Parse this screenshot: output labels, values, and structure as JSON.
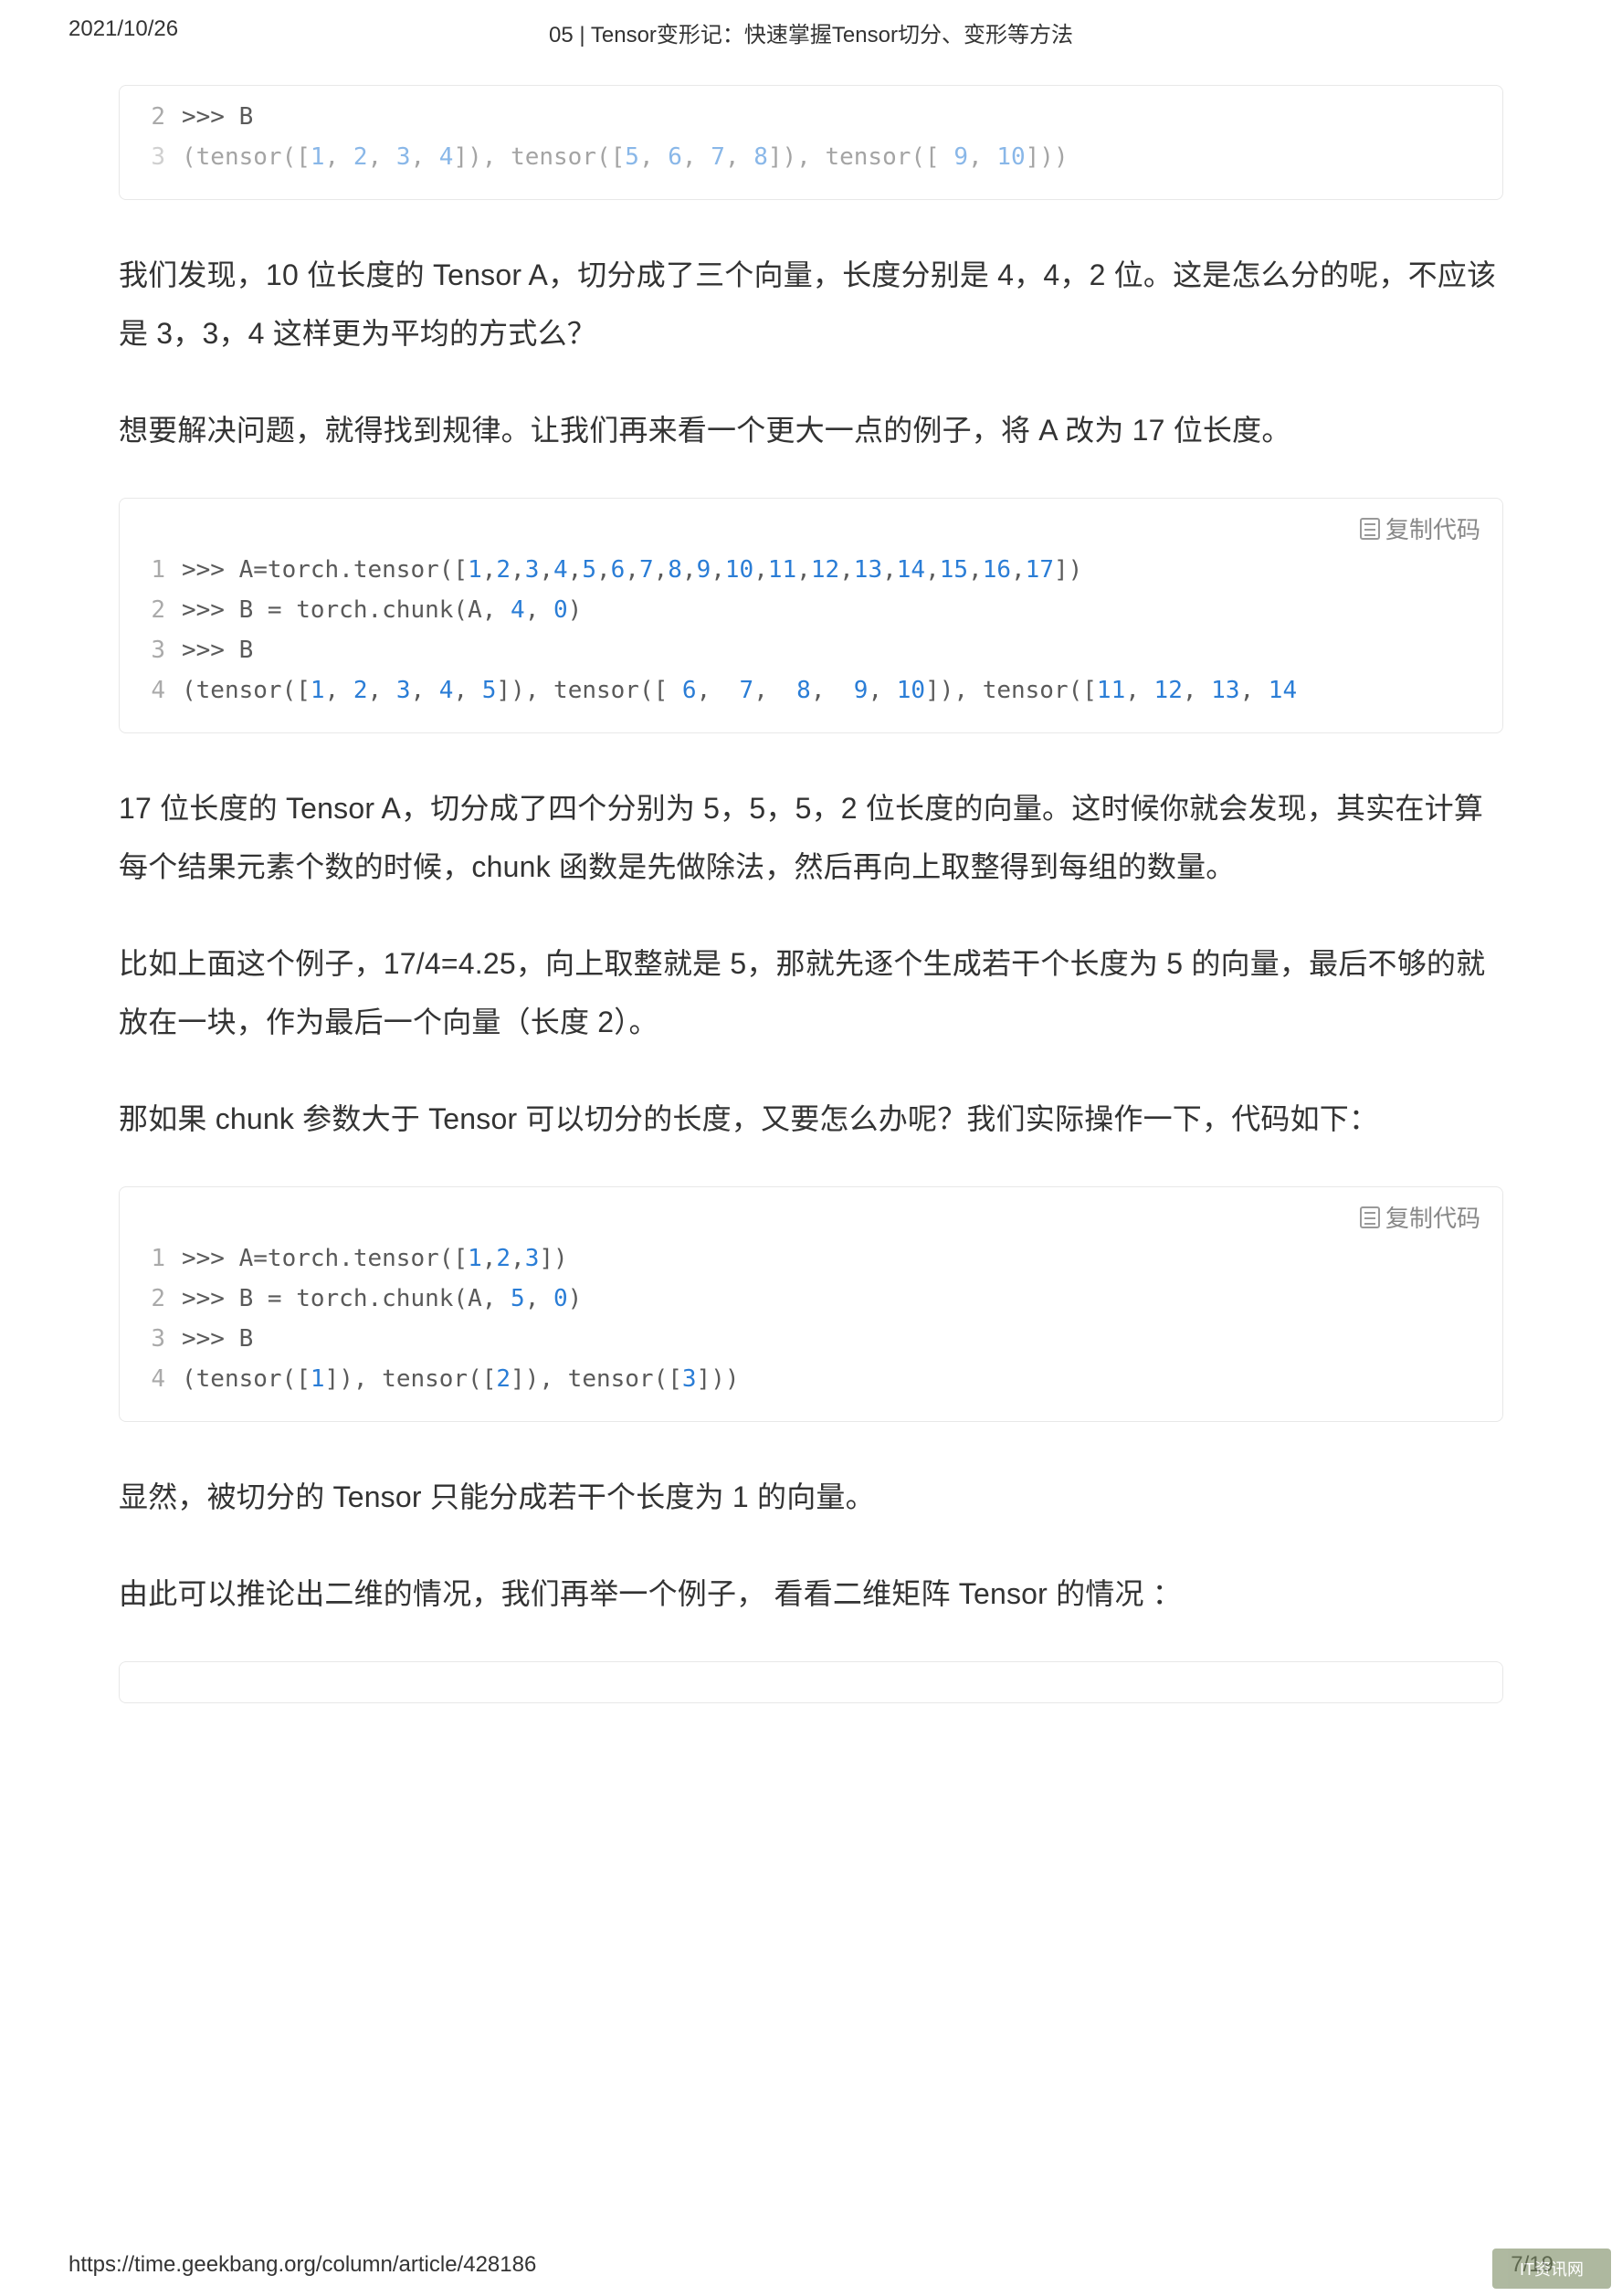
{
  "header": {
    "date": "2021/10/26",
    "title": "05 | Tensor变形记：快速掌握Tensor切分、变形等方法"
  },
  "copy_label": "复制代码",
  "code1": {
    "lines": [
      {
        "n": "2",
        "html": ">>> B"
      },
      {
        "n": "3",
        "html": "(tensor([<span class='tok-num'>1</span>, <span class='tok-num'>2</span>, <span class='tok-num'>3</span>, <span class='tok-num'>4</span>]), tensor([<span class='tok-num'>5</span>, <span class='tok-num'>6</span>, <span class='tok-num'>7</span>, <span class='tok-num'>8</span>]), tensor([ <span class='tok-num'>9</span>, <span class='tok-num'>10</span>]))"
      }
    ]
  },
  "p1": "我们发现，10 位长度的 Tensor A，切分成了三个向量，长度分别是 4，4，2 位。这是怎么分的呢，不应该是 3，3，4 这样更为平均的方式么？",
  "p2": "想要解决问题，就得找到规律。让我们再来看一个更大一点的例子，将 A 改为 17 位长度。",
  "code2": {
    "lines": [
      {
        "n": "1",
        "html": ">>> A=torch.tensor([<span class='tok-num'>1</span>,<span class='tok-num'>2</span>,<span class='tok-num'>3</span>,<span class='tok-num'>4</span>,<span class='tok-num'>5</span>,<span class='tok-num'>6</span>,<span class='tok-num'>7</span>,<span class='tok-num'>8</span>,<span class='tok-num'>9</span>,<span class='tok-num'>10</span>,<span class='tok-num'>11</span>,<span class='tok-num'>12</span>,<span class='tok-num'>13</span>,<span class='tok-num'>14</span>,<span class='tok-num'>15</span>,<span class='tok-num'>16</span>,<span class='tok-num'>17</span>])"
      },
      {
        "n": "2",
        "html": ">>> B = torch.chunk(A, <span class='tok-num'>4</span>, <span class='tok-num'>0</span>)"
      },
      {
        "n": "3",
        "html": ">>> B"
      },
      {
        "n": "4",
        "html": "(tensor([<span class='tok-num'>1</span>, <span class='tok-num'>2</span>, <span class='tok-num'>3</span>, <span class='tok-num'>4</span>, <span class='tok-num'>5</span>]), tensor([ <span class='tok-num'>6</span>,  <span class='tok-num'>7</span>,  <span class='tok-num'>8</span>,  <span class='tok-num'>9</span>, <span class='tok-num'>10</span>]), tensor([<span class='tok-num'>11</span>, <span class='tok-num'>12</span>, <span class='tok-num'>13</span>, <span class='tok-num'>14</span>"
      }
    ]
  },
  "p3": "17 位长度的 Tensor A，切分成了四个分别为 5，5，5，2 位长度的向量。这时候你就会发现，其实在计算每个结果元素个数的时候，chunk 函数是先做除法，然后再向上取整得到每组的数量。",
  "p4": "比如上面这个例子，17/4=4.25，向上取整就是 5，那就先逐个生成若干个长度为 5 的向量，最后不够的就放在一块，作为最后一个向量（长度 2）。",
  "p5": "那如果 chunk 参数大于 Tensor 可以切分的长度，又要怎么办呢？我们实际操作一下，代码如下：",
  "code3": {
    "lines": [
      {
        "n": "1",
        "html": ">>> A=torch.tensor([<span class='tok-num'>1</span>,<span class='tok-num'>2</span>,<span class='tok-num'>3</span>])"
      },
      {
        "n": "2",
        "html": ">>> B = torch.chunk(A, <span class='tok-num'>5</span>, <span class='tok-num'>0</span>)"
      },
      {
        "n": "3",
        "html": ">>> B"
      },
      {
        "n": "4",
        "html": "(tensor([<span class='tok-num'>1</span>]), tensor([<span class='tok-num'>2</span>]), tensor([<span class='tok-num'>3</span>]))"
      }
    ]
  },
  "p6": "显然，被切分的 Tensor 只能分成若干个长度为 1 的向量。",
  "p7": "由此可以推论出二维的情况，我们再举一个例子， 看看二维矩阵 Tensor 的情况 ：",
  "footer": {
    "url": "https://time.geekbang.org/column/article/428186",
    "page": "7/19"
  },
  "watermark": "IT资讯网"
}
